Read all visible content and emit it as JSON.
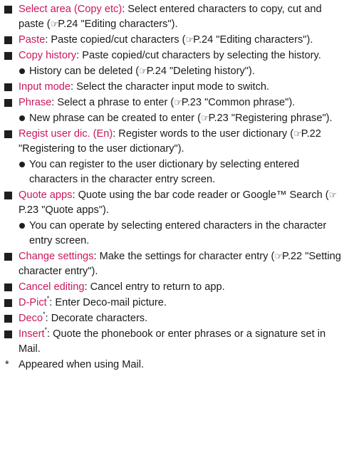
{
  "ref_icon": "☞",
  "items": [
    {
      "term": "Select area (Copy etc)",
      "desc": ": Select entered characters to copy, cut and paste (",
      "ref": "P.24 \"Editing characters\")."
    },
    {
      "term": "Paste",
      "desc": ": Paste copied/cut characters (",
      "ref": "P.24 \"Editing characters\")."
    },
    {
      "term": "Copy history",
      "desc": ": Paste copied/cut characters by selecting the history.",
      "ref": ""
    },
    {
      "sub": "History can be deleted (",
      "ref": "P.24 \"Deleting history\")."
    },
    {
      "term": "Input mode",
      "desc": ": Select the character input mode to switch.",
      "ref": ""
    },
    {
      "term": "Phrase",
      "desc": ": Select a phrase to enter (",
      "ref": "P.23 \"Common phrase\")."
    },
    {
      "sub": "New phrase can be created to enter (",
      "ref": "P.23 \"Registering phrase\")."
    },
    {
      "term": "Regist user dic. (En)",
      "desc": ": Register words to the user dictionary (",
      "ref": "P.22 \"Registering to the user dictionary\")."
    },
    {
      "sub": "You can register to the user dictionary by selecting entered characters in the character entry screen.",
      "ref": ""
    },
    {
      "term": "Quote apps",
      "desc": ": Quote using the bar code reader or Google™ Search (",
      "ref": "P.23 \"Quote apps\")."
    },
    {
      "sub": "You can operate by selecting entered characters in the character entry screen.",
      "ref": ""
    },
    {
      "term": "Change settings",
      "desc": ": Make the settings for character entry (",
      "ref": "P.22 \"Setting character entry\")."
    },
    {
      "term": "Cancel editing",
      "desc": ": Cancel entry to return to app.",
      "ref": ""
    },
    {
      "term": "D-Pict",
      "mark": "*",
      "desc": ": Enter Deco-mail picture.",
      "ref": ""
    },
    {
      "term": "Deco",
      "mark": "*",
      "desc": ": Decorate characters.",
      "ref": ""
    },
    {
      "term": "Insert",
      "mark": "*",
      "desc": ": Quote the phonebook or enter phrases or a signature set in Mail.",
      "ref": ""
    }
  ],
  "footnote": {
    "mark": "*",
    "text": "Appeared when using Mail."
  },
  "colors": {
    "term": "#c8175d",
    "text": "#1a1a1a"
  }
}
